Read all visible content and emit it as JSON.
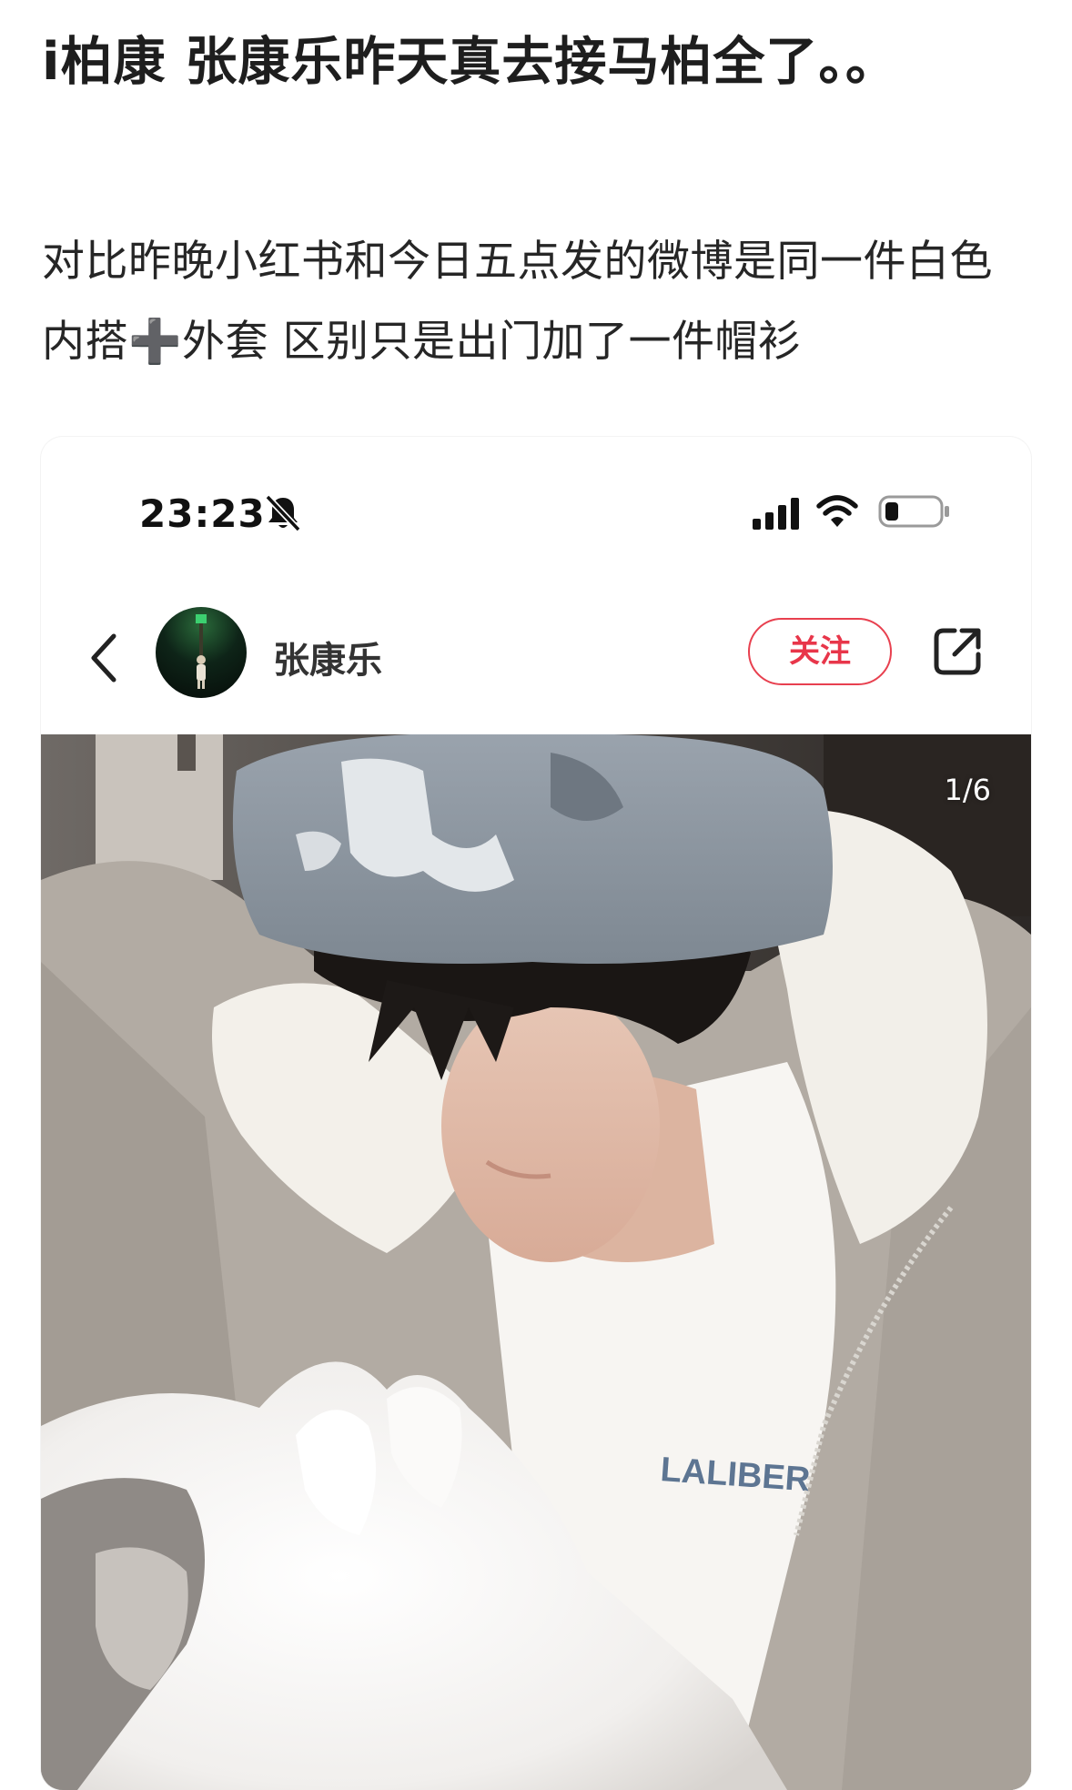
{
  "article": {
    "title": "i柏康 张康乐昨天真去接马柏全了。。",
    "body": "对比昨晚小红书和今日五点发的微博是同一件白色内搭➕外套 区别只是出门加了一件帽衫"
  },
  "status_bar": {
    "time": "23:23",
    "icons": [
      "bell-muted-icon",
      "signal-icon",
      "wifi-icon",
      "battery-icon"
    ]
  },
  "post_header": {
    "author_name": "张康乐",
    "follow_label": "关注",
    "icons": [
      "back-chevron-icon",
      "avatar",
      "share-icon"
    ]
  },
  "photo": {
    "counter": "1/6",
    "shirt_text": "LALIBER"
  },
  "colors": {
    "follow_accent": "#e8404f",
    "text_primary": "#1e1e1e"
  }
}
